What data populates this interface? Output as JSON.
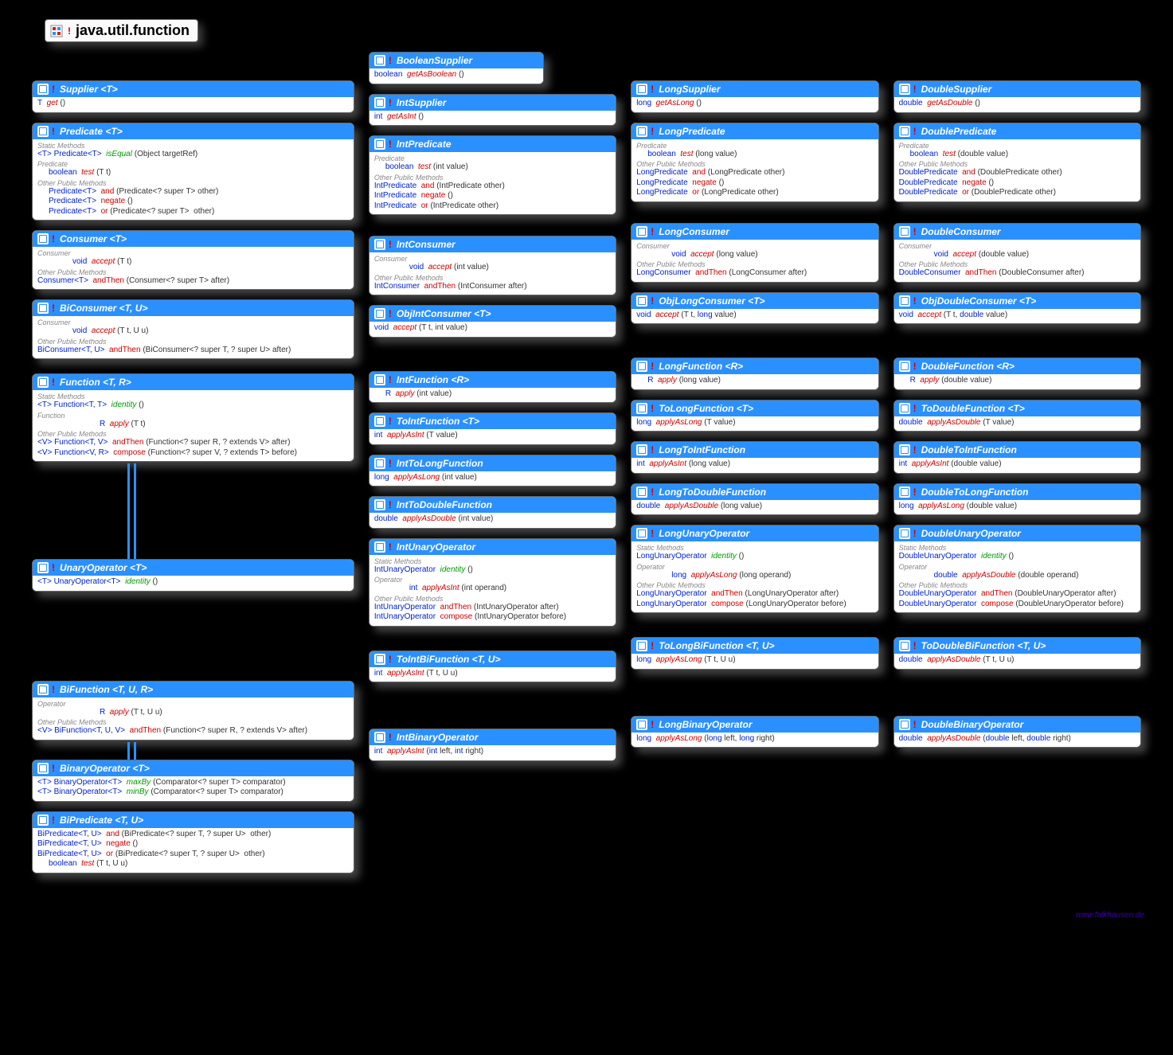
{
  "title": "java.util.function",
  "credit": "www.falkhausen.de",
  "lines": {
    "supplier_get": "T  get ()",
    "booleansupplier_get": "boolean  getAsBoolean ()",
    "intsupplier_get": "int  getAsInt ()",
    "longsupplier_get": "long  getAsLong ()",
    "doublesupplier_get": "double  getAsDouble ()",
    "pred_static": "<T> Predicate<T>  isEqual (Object targetRef)",
    "pred_test": "boolean  test (T t)",
    "pred_and": "Predicate<T>  and (Predicate<? super T> other)",
    "pred_negate": "Predicate<T>  negate ()",
    "pred_or": "Predicate<T>  or (Predicate<? super T>  other)",
    "intpred_test": "boolean  test (int value)",
    "intpred_and": "IntPredicate  and (IntPredicate other)",
    "intpred_negate": "IntPredicate  negate ()",
    "intpred_or": "IntPredicate  or (IntPredicate other)",
    "longpred_test": "boolean  test (long value)",
    "longpred_and": "LongPredicate  and (LongPredicate other)",
    "longpred_negate": "LongPredicate  negate ()",
    "longpred_or": "LongPredicate  or (LongPredicate other)",
    "dblpred_test": "boolean  test (double value)",
    "dblpred_and": "DoublePredicate  and (DoublePredicate other)",
    "dblpred_negate": "DoublePredicate  negate ()",
    "dblpred_or": "DoublePredicate  or (DoublePredicate other)",
    "cons_accept": "void  accept (T t)",
    "cons_andthen": "Consumer<T>  andThen (Consumer<? super T> after)",
    "intcons_accept": "void  accept (int value)",
    "intcons_andthen": "IntConsumer  andThen (IntConsumer after)",
    "longcons_accept": "void  accept (long value)",
    "longcons_andthen": "LongConsumer  andThen (LongConsumer after)",
    "dblcons_accept": "void  accept (double value)",
    "dblcons_andthen": "DoubleConsumer  andThen (DoubleConsumer after)",
    "bicons_accept": "void  accept (T t, U u)",
    "bicons_andthen": "BiConsumer<T, U>  andThen (BiConsumer<? super T, ? super U> after)",
    "objintcons": "void  accept (T t, int value)",
    "objlongcons": "void  accept (T t, long value)",
    "objdblcons": "void  accept (T t, double value)",
    "func_static": "<T> Function<T, T>  identity ()",
    "func_apply": "R  apply (T t)",
    "func_andthen": "<V> Function<T, V>  andThen (Function<? super R, ? extends V> after)",
    "func_compose": "<V> Function<V, R>  compose (Function<? super V, ? extends T> before)",
    "intfunc_apply": "R  apply (int value)",
    "longfunc_apply": "R  apply (long value)",
    "dblfunc_apply": "R  apply (double value)",
    "tointfunc": "int  applyAsInt (T value)",
    "tolongfunc": "long  applyAsLong (T value)",
    "todblfunc": "double  applyAsDouble (T value)",
    "inttolong": "long  applyAsLong (int value)",
    "longtoint": "int  applyAsInt (long value)",
    "dbltoint": "int  applyAsInt (double value)",
    "inttodbl": "double  applyAsDouble (int value)",
    "longtodbl": "double  applyAsDouble (long value)",
    "dbltolong": "long  applyAsLong (double value)",
    "unary_identity": "<T> UnaryOperator<T>  identity ()",
    "intunary_identity": "IntUnaryOperator  identity ()",
    "intunary_apply": "int  applyAsInt (int operand)",
    "intunary_andthen": "IntUnaryOperator  andThen (IntUnaryOperator after)",
    "intunary_compose": "IntUnaryOperator  compose (IntUnaryOperator before)",
    "longunary_identity": "LongUnaryOperator  identity ()",
    "longunary_apply": "long  applyAsLong (long operand)",
    "longunary_andthen": "LongUnaryOperator  andThen (LongUnaryOperator after)",
    "longunary_compose": "LongUnaryOperator  compose (LongUnaryOperator before)",
    "dblunary_identity": "DoubleUnaryOperator  identity ()",
    "dblunary_apply": "double  applyAsDouble (double operand)",
    "dblunary_andthen": "DoubleUnaryOperator  andThen (DoubleUnaryOperator after)",
    "dblunary_compose": "DoubleUnaryOperator  compose (DoubleUnaryOperator before)",
    "bifunc_apply": "R  apply (T t, U u)",
    "bifunc_andthen": "<V> BiFunction<T, U, V>  andThen (Function<? super R, ? extends V> after)",
    "tointbifunc": "int  applyAsInt (T t, U u)",
    "tolongbifunc": "long  applyAsLong (T t, U u)",
    "todblbifunc": "double  applyAsDouble (T t, U u)",
    "binop_maxby": "<T> BinaryOperator<T>  maxBy (Comparator<? super T> comparator)",
    "binop_minby": "<T> BinaryOperator<T>  minBy (Comparator<? super T> comparator)",
    "intbinop": "int  applyAsInt (int left, int right)",
    "longbinop": "long  applyAsLong (long left, long right)",
    "dblbinop": "double  applyAsDouble (double left, double right)",
    "bipred_and": "BiPredicate<T, U>  and (BiPredicate<? super T, ? super U>  other)",
    "bipred_negate": "BiPredicate<T, U>  negate ()",
    "bipred_or": "BiPredicate<T, U>  or (BiPredicate<? super T, ? super U>  other)",
    "bipred_test": "boolean  test (T t, U u)"
  },
  "labels": {
    "static": "Static Methods",
    "predicate": "Predicate",
    "other": "Other Public Methods",
    "consumer": "Consumer",
    "function": "Function",
    "operator": "Operator"
  },
  "titles": {
    "Supplier": "Supplier <T>",
    "BooleanSupplier": "BooleanSupplier",
    "IntSupplier": "IntSupplier",
    "LongSupplier": "LongSupplier",
    "DoubleSupplier": "DoubleSupplier",
    "Predicate": "Predicate <T>",
    "IntPredicate": "IntPredicate",
    "LongPredicate": "LongPredicate",
    "DoublePredicate": "DoublePredicate",
    "Consumer": "Consumer <T>",
    "IntConsumer": "IntConsumer",
    "LongConsumer": "LongConsumer",
    "DoubleConsumer": "DoubleConsumer",
    "BiConsumer": "BiConsumer <T, U>",
    "ObjIntConsumer": "ObjIntConsumer <T>",
    "ObjLongConsumer": "ObjLongConsumer <T>",
    "ObjDoubleConsumer": "ObjDoubleConsumer <T>",
    "Function": "Function <T, R>",
    "IntFunction": "IntFunction <R>",
    "LongFunction": "LongFunction <R>",
    "DoubleFunction": "DoubleFunction <R>",
    "ToIntFunction": "ToIntFunction <T>",
    "ToLongFunction": "ToLongFunction <T>",
    "ToDoubleFunction": "ToDoubleFunction <T>",
    "IntToLongFunction": "IntToLongFunction",
    "LongToIntFunction": "LongToIntFunction",
    "DoubleToIntFunction": "DoubleToIntFunction",
    "IntToDoubleFunction": "IntToDoubleFunction",
    "LongToDoubleFunction": "LongToDoubleFunction",
    "DoubleToLongFunction": "DoubleToLongFunction",
    "UnaryOperator": "UnaryOperator <T>",
    "IntUnaryOperator": "IntUnaryOperator",
    "LongUnaryOperator": "LongUnaryOperator",
    "DoubleUnaryOperator": "DoubleUnaryOperator",
    "BiFunction": "BiFunction <T, U, R>",
    "ToIntBiFunction": "ToIntBiFunction <T, U>",
    "ToLongBiFunction": "ToLongBiFunction <T, U>",
    "ToDoubleBiFunction": "ToDoubleBiFunction <T, U>",
    "BinaryOperator": "BinaryOperator <T>",
    "IntBinaryOperator": "IntBinaryOperator",
    "LongBinaryOperator": "LongBinaryOperator",
    "DoubleBinaryOperator": "DoubleBinaryOperator",
    "BiPredicate": "BiPredicate <T, U>"
  }
}
